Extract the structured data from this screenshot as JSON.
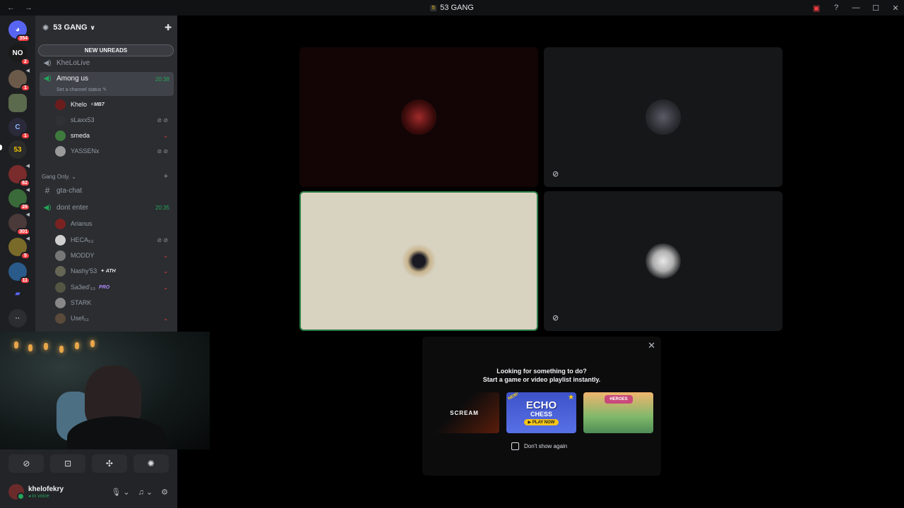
{
  "window": {
    "title": "53 GANG",
    "nav_back": "←",
    "nav_forward": "→"
  },
  "server_rail": {
    "items": [
      {
        "name": "direct-messages",
        "label": "",
        "count": "354",
        "color": "#5865f2"
      },
      {
        "name": "server-no",
        "label": "NO",
        "count": "2",
        "color": "#1a1a1a"
      },
      {
        "name": "server-3",
        "label": "",
        "count": "1",
        "color": "#6b5a4a"
      },
      {
        "name": "server-4",
        "label": "",
        "count": "",
        "color": "#5b6a4c"
      },
      {
        "name": "server-5",
        "label": "",
        "count": "1",
        "color": "#2a2a3a"
      },
      {
        "name": "server-53-gang",
        "label": "53",
        "count": "",
        "color": "#2b2b2b"
      },
      {
        "name": "server-7",
        "label": "",
        "count": "62",
        "color": "#7a2b2b"
      },
      {
        "name": "server-8",
        "label": "",
        "count": "26",
        "color": "#3a6a3a"
      },
      {
        "name": "server-9",
        "label": "",
        "count": "301",
        "color": "#4a3a3a"
      },
      {
        "name": "server-10",
        "label": "",
        "count": "5",
        "color": "#7a6a2a"
      },
      {
        "name": "server-11",
        "label": "",
        "count": "11",
        "color": "#2a5a8a"
      }
    ]
  },
  "sidebar": {
    "server_name": "53 GANG",
    "new_unreads": "NEW UNREADS",
    "channels": {
      "khelolive": "KheLoLive",
      "among_us": "Among us",
      "among_us_time": "20:38",
      "among_us_status": "Set a channel status",
      "category": "Gang Only.",
      "gta_chat": "gta-chat",
      "dont_enter": "dont enter",
      "dont_enter_time": "20:35"
    },
    "among_us_users": [
      {
        "name": "Khelo",
        "tag": "⚡MB7"
      },
      {
        "name": "sLaxx53",
        "tag": ""
      },
      {
        "name": "smeda",
        "tag": ""
      },
      {
        "name": "YASSENx",
        "tag": ""
      }
    ],
    "dont_enter_users": [
      {
        "name": "Arianus",
        "tag": ""
      },
      {
        "name": "HECA₅₃",
        "tag": ""
      },
      {
        "name": "MODDY",
        "tag": ""
      },
      {
        "name": "Nashy'53",
        "tag": "✦ ATH"
      },
      {
        "name": "Sa3ed'₅₃",
        "tag": "PRO"
      },
      {
        "name": "STARK",
        "tag": ""
      },
      {
        "name": "Usef₅₃",
        "tag": ""
      }
    ]
  },
  "user_panel": {
    "username": "khelofekry",
    "status": "In voice"
  },
  "activity_popup": {
    "line1": "Looking for something to do?",
    "line2": "Start a game or video playlist instantly.",
    "games": [
      {
        "title": "SCREAM"
      },
      {
        "title": "ECHO",
        "subtitle": "CHESS",
        "badge": "NEW!",
        "button": "PLAY NOW"
      },
      {
        "title": "HEROES"
      }
    ],
    "dont_show_again": "Don't show again"
  },
  "colors": {
    "accent_green": "#23a559",
    "speaking_border": "#2d7d46",
    "alert_red": "#f23f43"
  }
}
